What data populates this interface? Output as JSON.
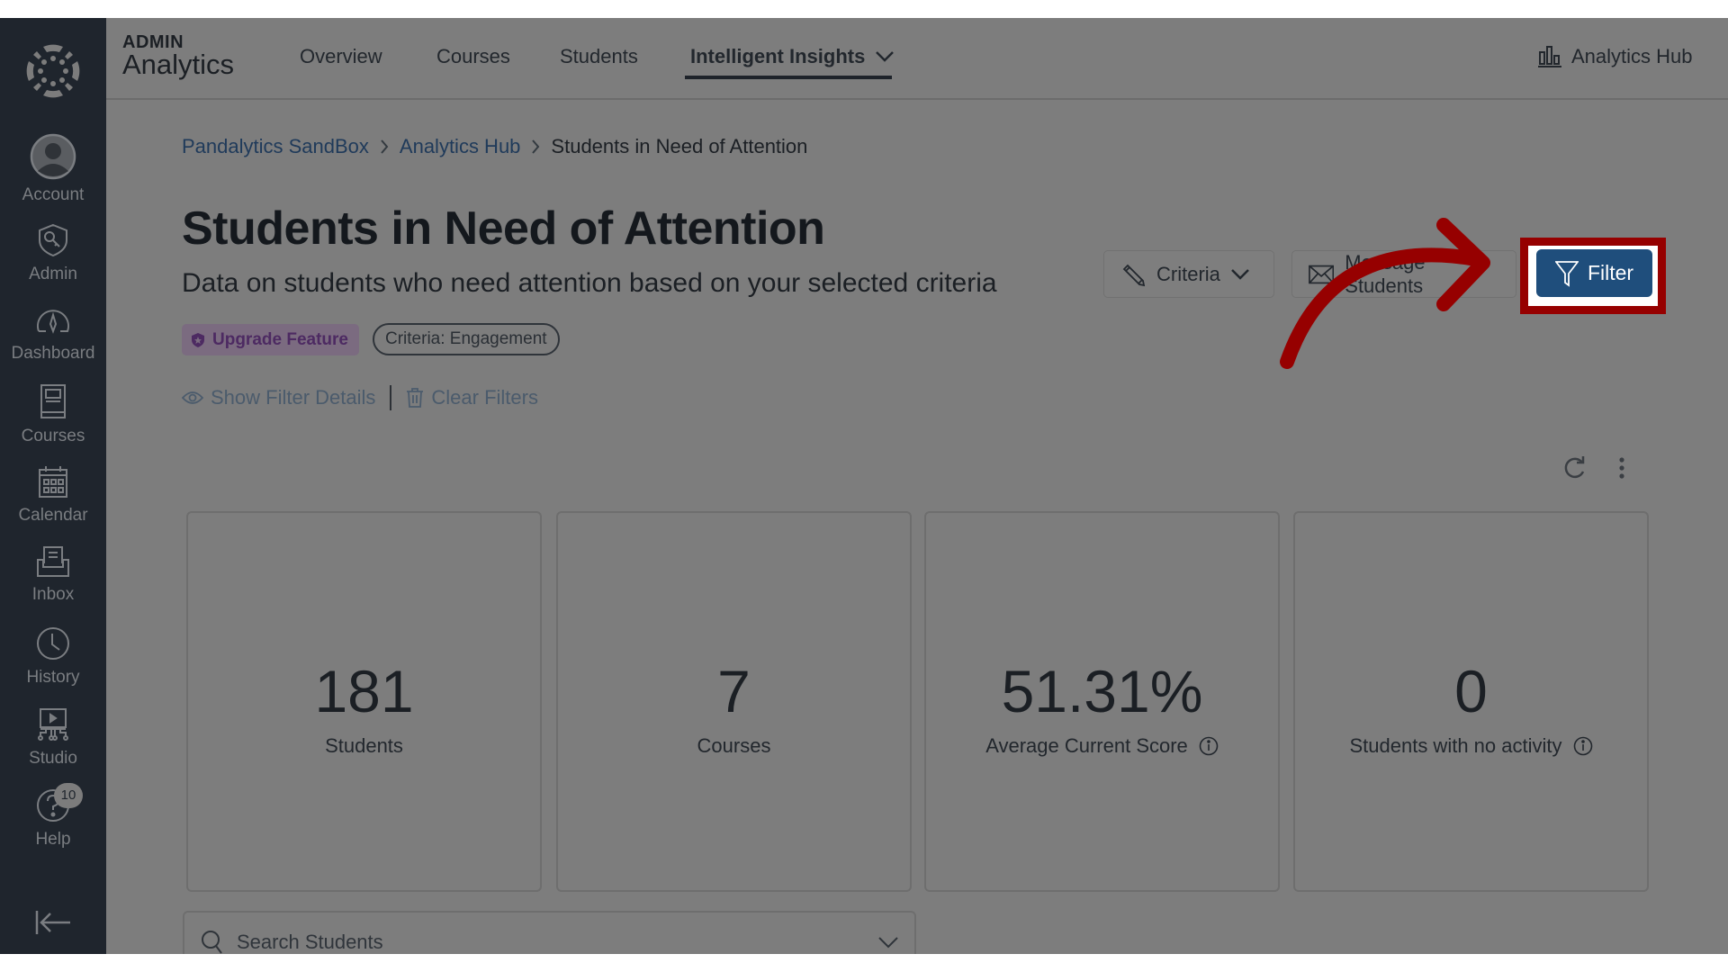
{
  "sidebar": {
    "items": [
      {
        "label": "Account",
        "icon": "account-icon"
      },
      {
        "label": "Admin",
        "icon": "admin-icon"
      },
      {
        "label": "Dashboard",
        "icon": "dashboard-icon"
      },
      {
        "label": "Courses",
        "icon": "courses-icon"
      },
      {
        "label": "Calendar",
        "icon": "calendar-icon"
      },
      {
        "label": "Inbox",
        "icon": "inbox-icon"
      },
      {
        "label": "History",
        "icon": "history-icon"
      },
      {
        "label": "Studio",
        "icon": "studio-icon"
      },
      {
        "label": "Help",
        "icon": "help-icon",
        "badge": "10"
      }
    ]
  },
  "header": {
    "brand_small": "ADMIN",
    "brand_big": "Analytics",
    "nav": [
      {
        "label": "Overview"
      },
      {
        "label": "Courses"
      },
      {
        "label": "Students"
      },
      {
        "label": "Intelligent Insights",
        "active": true
      }
    ],
    "hub_link": "Analytics Hub"
  },
  "breadcrumb": [
    {
      "label": "Pandalytics SandBox",
      "link": true
    },
    {
      "label": "Analytics Hub",
      "link": true
    },
    {
      "label": "Students in Need of Attention",
      "link": false
    }
  ],
  "page": {
    "title": "Students in Need of Attention",
    "subtitle": "Data on students who need attention based on your selected criteria",
    "upgrade_badge": "Upgrade Feature",
    "criteria_badge": "Criteria: Engagement",
    "show_filter_details": "Show Filter Details",
    "clear_filters": "Clear Filters"
  },
  "actions": {
    "criteria": "Criteria",
    "message_students": "Message Students",
    "filter": "Filter"
  },
  "cards": [
    {
      "value": "181",
      "label": "Students",
      "info": false
    },
    {
      "value": "7",
      "label": "Courses",
      "info": false
    },
    {
      "value": "51.31%",
      "label": "Average Current Score",
      "info": true
    },
    {
      "value": "0",
      "label": "Students with no activity",
      "info": true
    }
  ],
  "search": {
    "placeholder": "Search Students",
    "value": ""
  },
  "colors": {
    "highlight": "#960000",
    "filter_button": "#1f4e7c",
    "upgrade_badge": "#4d2a62",
    "link": "#1f3a5a"
  }
}
